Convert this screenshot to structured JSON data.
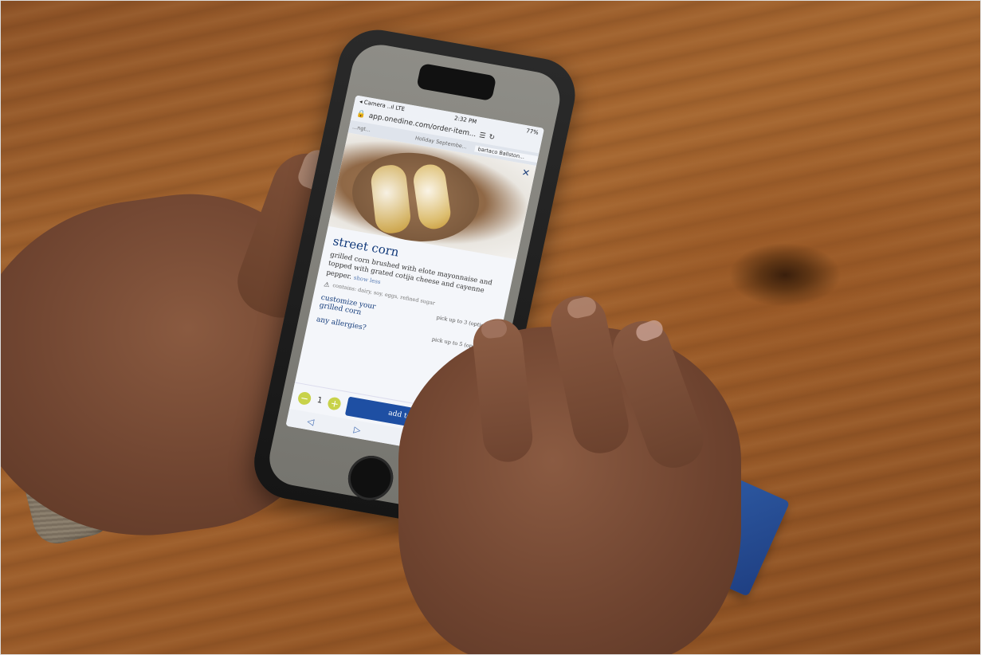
{
  "status_bar": {
    "carrier": "◂ Camera ..ıl LTE",
    "time": "2:32 PM",
    "battery": "77%"
  },
  "browser": {
    "url": "app.onedine.com/order-item...",
    "tabs": [
      "...ngt...",
      "Holiday Septembe...",
      "bartaco Ballston..."
    ]
  },
  "menu_item": {
    "name": "street corn",
    "description": "grilled corn brushed with elote mayonnaise and topped with grated cotija cheese and cayenne pepper.",
    "show_less": "show less",
    "allergens": "contains: dairy, soy, eggs, refined sugar"
  },
  "options": [
    {
      "label": "customize your grilled corn",
      "hint": "pick up to 3 (optional)"
    },
    {
      "label": "any allergies?",
      "hint": "pick up to 5 (optional)"
    }
  ],
  "order": {
    "quantity": "1",
    "add_label": "add to order"
  },
  "card": {
    "brand": "onedine"
  },
  "colors": {
    "accent": "#1e4fa3",
    "stepper": "#c8d24a",
    "title": "#123a7a"
  }
}
